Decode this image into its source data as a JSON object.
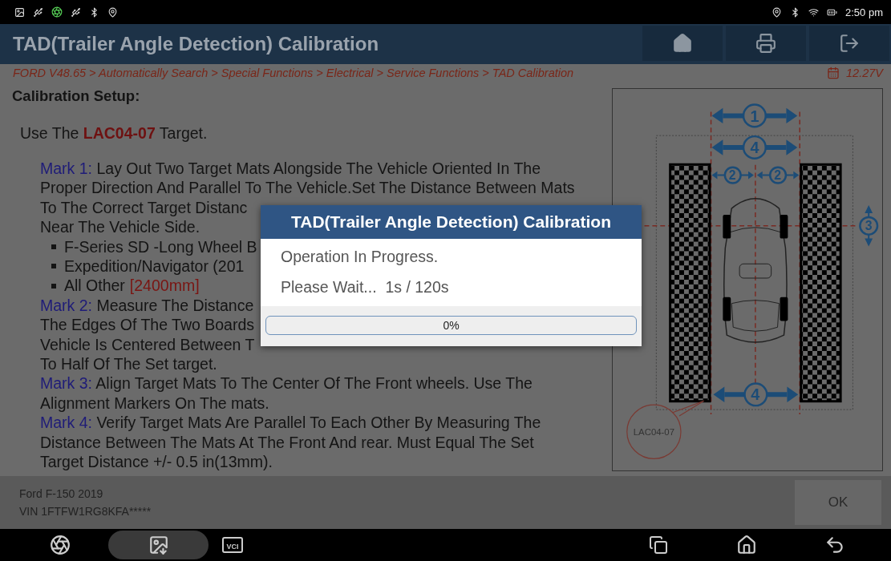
{
  "status_bar": {
    "time": "2:50 pm"
  },
  "header": {
    "title": "TAD(Trailer Angle Detection) Calibration"
  },
  "breadcrumb": {
    "path": "FORD V48.65 > Automatically Search > Special Functions > Electrical > Service Functions > TAD Calibration",
    "voltage": "12.27V"
  },
  "content": {
    "heading": "Calibration Setup:",
    "intro": {
      "prefix": "Use The",
      "target": "LAC04-07",
      "suffix": "Target."
    },
    "marks": [
      {
        "label": "Mark 1:",
        "lines": [
          "Lay Out Two Target Mats Alongside The Vehicle Oriented In The",
          "Proper Direction And Parallel To The Vehicle.Set The Distance Between Mats",
          "To The Correct Target Distanc",
          "Near The Vehicle Side."
        ],
        "bullets": [
          {
            "text": "F-Series SD -Long Wheel B"
          },
          {
            "text": "Expedition/Navigator (201"
          },
          {
            "text": "All Other",
            "value": "[2400mm]"
          }
        ]
      },
      {
        "label": "Mark 2:",
        "lines": [
          "Measure The Distance",
          "The Edges Of The Two Boards",
          "Vehicle Is Centered Between T",
          "To Half Of The Set target."
        ]
      },
      {
        "label": "Mark 3:",
        "lines": [
          "Align Target Mats To The Center Of The Front wheels. Use The",
          "Alignment Markers On The mats."
        ]
      },
      {
        "label": "Mark 4:",
        "lines": [
          "Verify Target Mats Are Parallel To Each Other By Measuring The",
          "Distance Between The Mats At The Front And rear. Must Equal The Set",
          "Target Distance +/- 0.5 in(13mm)."
        ]
      }
    ]
  },
  "diagram": {
    "markers": [
      "1",
      "4",
      "2",
      "2",
      "3",
      "4"
    ],
    "target_label": "LAC04-07"
  },
  "dialog": {
    "title": "TAD(Trailer Angle Detection) Calibration",
    "lines": [
      "Operation In Progress.",
      "Please Wait...  1s / 120s"
    ],
    "progress": {
      "level": 0,
      "text": "0%"
    }
  },
  "footer": {
    "vehicle": "Ford F-150 2019",
    "vin": "VIN 1FTFW1RG8KFA*****",
    "ok": "OK"
  },
  "nav": {
    "vci_label": "VCI"
  }
}
